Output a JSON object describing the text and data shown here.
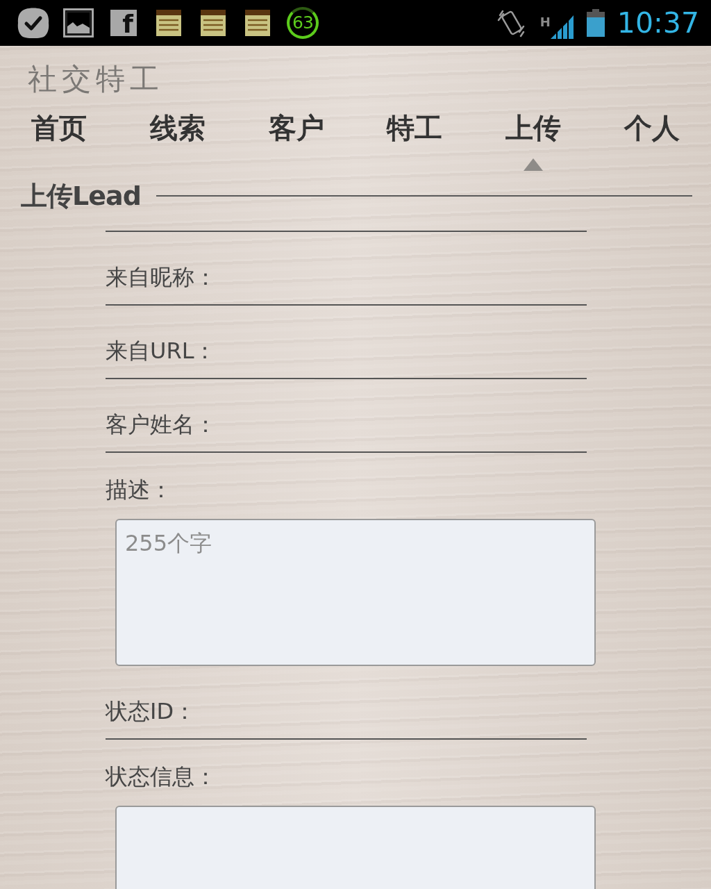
{
  "status_bar": {
    "app_glyph": "f",
    "counter": "63",
    "network_type": "H",
    "time": "10:37"
  },
  "app": {
    "title": "社交特工"
  },
  "tabs": [
    {
      "label": "首页",
      "selected": false
    },
    {
      "label": "线索",
      "selected": false
    },
    {
      "label": "客户",
      "selected": false
    },
    {
      "label": "特工",
      "selected": false
    },
    {
      "label": "上传",
      "selected": true
    },
    {
      "label": "个人",
      "selected": false
    }
  ],
  "section": {
    "title": "上传Lead"
  },
  "form": {
    "fields": [
      {
        "kind": "line",
        "label": "来自昵称："
      },
      {
        "kind": "line",
        "label": "来自URL："
      },
      {
        "kind": "line",
        "label": "客户姓名："
      },
      {
        "kind": "area",
        "label": "描述：",
        "placeholder": "255个字"
      },
      {
        "kind": "line",
        "label": "状态ID："
      },
      {
        "kind": "area",
        "label": "状态信息："
      }
    ]
  }
}
